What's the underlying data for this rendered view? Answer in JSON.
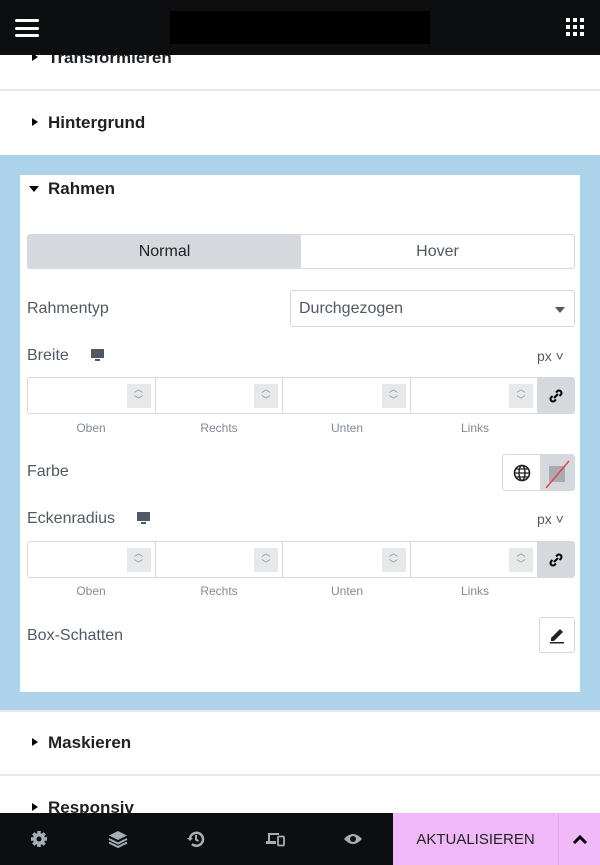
{
  "header": {
    "menu_icon": "hamburger-icon",
    "apps_icon": "grid-icon"
  },
  "sections": {
    "transform": "Transformieren",
    "background": "Hintergrund",
    "border": "Rahmen",
    "mask": "Maskieren",
    "responsive": "Responsiv"
  },
  "border": {
    "tabs": [
      {
        "label": "Normal",
        "active": true
      },
      {
        "label": "Hover",
        "active": false
      }
    ],
    "border_type": {
      "label": "Rahmentyp",
      "value": "Durchgezogen"
    },
    "width": {
      "label": "Breite",
      "unit": "px"
    },
    "sides": [
      "Oben",
      "Rechts",
      "Unten",
      "Links"
    ],
    "color": {
      "label": "Farbe"
    },
    "radius": {
      "label": "Eckenradius",
      "unit": "px"
    },
    "shadow": {
      "label": "Box-Schatten"
    }
  },
  "footer": {
    "update_label": "AKTUALISIEREN",
    "icons": [
      "settings-icon",
      "layers-icon",
      "history-icon",
      "responsive-icon",
      "eye-icon",
      "chevron-up-icon"
    ]
  },
  "colors": {
    "accent": "#f0b8f7",
    "active_section_bg": "#add3ea",
    "bar": "#0d0e10"
  }
}
